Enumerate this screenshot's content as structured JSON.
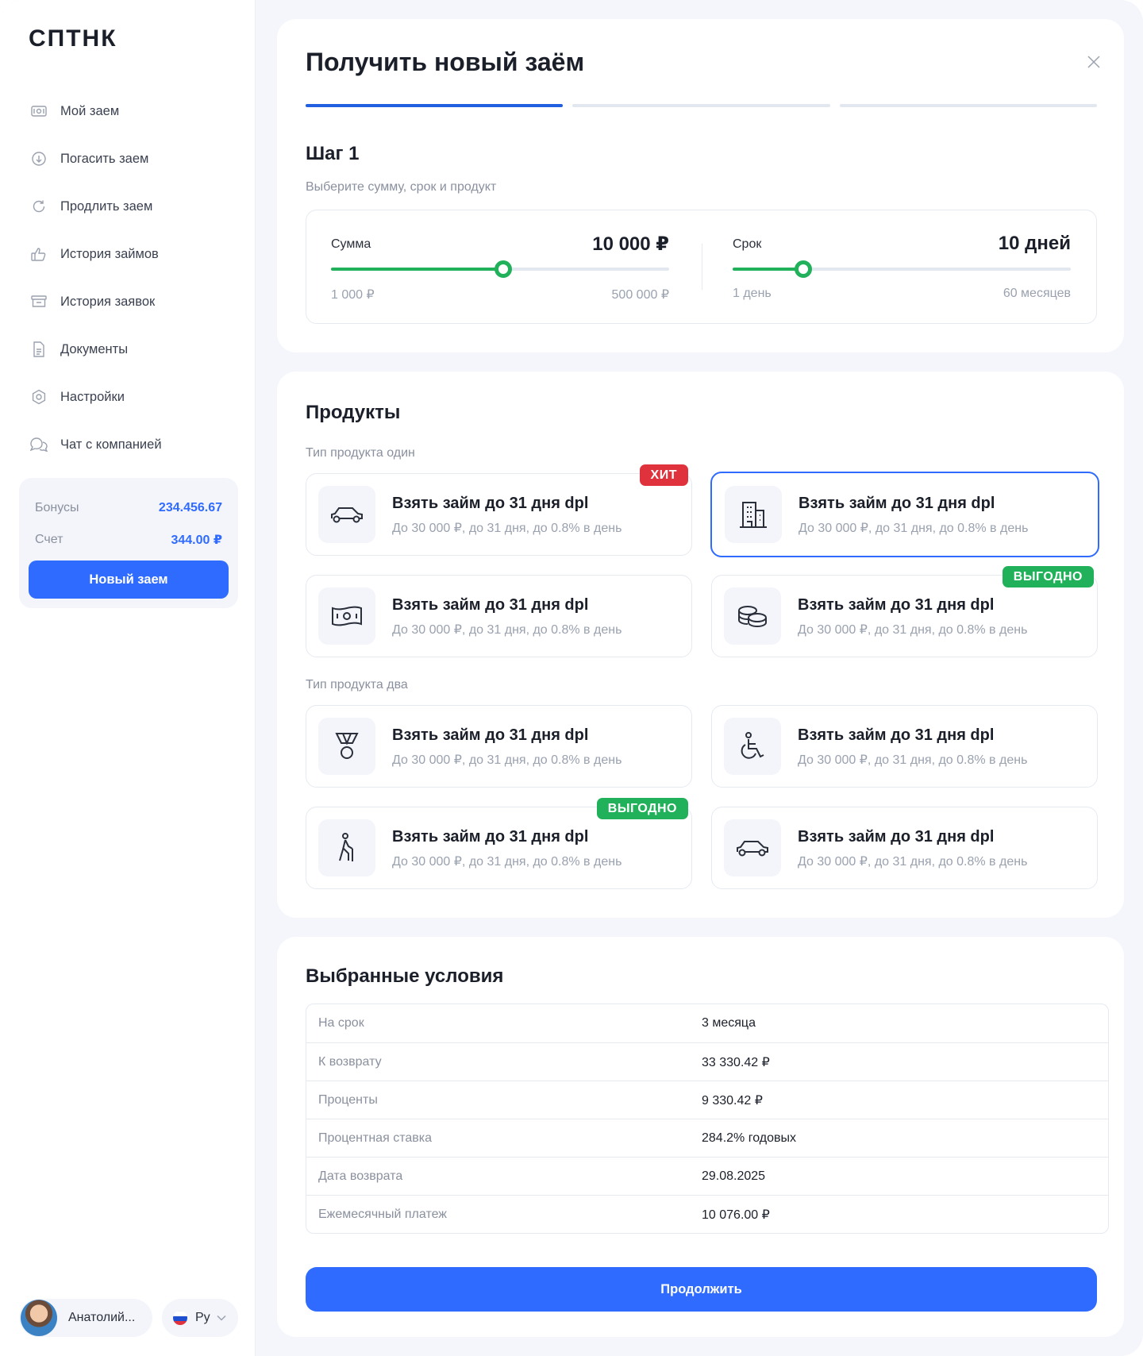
{
  "sidebar": {
    "logo": "СПТНК",
    "items": [
      {
        "label": "Мой заем",
        "icon": "money-icon"
      },
      {
        "label": "Погасить заем",
        "icon": "arrow-down-circle-icon"
      },
      {
        "label": "Продлить заем",
        "icon": "refresh-icon"
      },
      {
        "label": "История займов",
        "icon": "thumb-up-icon"
      },
      {
        "label": "История заявок",
        "icon": "archive-icon"
      },
      {
        "label": "Документы",
        "icon": "document-icon"
      },
      {
        "label": "Настройки",
        "icon": "gear-icon"
      },
      {
        "label": "Чат с компанией",
        "icon": "chat-icon"
      }
    ],
    "wallet": {
      "bonus_label": "Бонусы",
      "bonus_value": "234.456.67",
      "account_label": "Счет",
      "account_value": "344.00 ₽",
      "new_loan": "Новый заем"
    },
    "user": {
      "name": "Анатолий..."
    },
    "lang": {
      "code": "Ру"
    }
  },
  "step": {
    "title": "Получить новый заём",
    "progress": {
      "current": 1,
      "total": 3
    },
    "heading": "Шаг 1",
    "subtitle": "Выберите сумму, срок и продукт",
    "amount": {
      "label": "Сумма",
      "value": "10 000 ₽",
      "min": "1 000 ₽",
      "max": "500 000 ₽",
      "fraction": 0.51
    },
    "term": {
      "label": "Срок",
      "value": "10 дней",
      "min": "1 день",
      "max": "60 месяцев",
      "fraction": 0.21
    }
  },
  "products": {
    "heading": "Продукты",
    "group1": "Тип продукта один",
    "group2": "Тип продукта два",
    "items": [
      {
        "title": "Взять займ до 31 дня dpl",
        "desc": "До 30 000 ₽, до 31 дня, до 0.8% в день",
        "icon": "car-icon",
        "badge": "ХИТ"
      },
      {
        "title": "Взять займ до 31 дня dpl",
        "desc": "До 30 000 ₽, до 31 дня, до 0.8% в день",
        "icon": "building-icon",
        "badge": ""
      },
      {
        "title": "Взять займ до 31 дня dpl",
        "desc": "До 30 000 ₽, до 31 дня, до 0.8% в день",
        "icon": "banknote-icon",
        "badge": ""
      },
      {
        "title": "Взять займ до 31 дня dpl",
        "desc": "До 30 000 ₽, до 31 дня, до 0.8% в день",
        "icon": "coins-icon",
        "badge": "ВЫГОДНО"
      },
      {
        "title": "Взять займ до 31 дня dpl",
        "desc": "До 30 000 ₽, до 31 дня, до 0.8% в день",
        "icon": "medal-icon",
        "badge": ""
      },
      {
        "title": "Взять займ до 31 дня dpl",
        "desc": "До 30 000 ₽, до 31 дня, до 0.8% в день",
        "icon": "wheelchair-icon",
        "badge": ""
      },
      {
        "title": "Взять займ до 31 дня dpl",
        "desc": "До 30 000 ₽, до 31 дня, до 0.8% в день",
        "icon": "elderly-icon",
        "badge": "ВЫГОДНО"
      },
      {
        "title": "Взять займ до 31 дня dpl",
        "desc": "До 30 000 ₽, до 31 дня, до 0.8% в день",
        "icon": "car-icon",
        "badge": ""
      }
    ]
  },
  "conditions": {
    "heading": "Выбранные условия",
    "rows": [
      {
        "k": "На срок",
        "v": "3 месяца"
      },
      {
        "k": "К возврату",
        "v": "33 330.42 ₽"
      },
      {
        "k": "Проценты",
        "v": "9 330.42 ₽"
      },
      {
        "k": "Процентная ставка",
        "v": "284.2% годовых"
      },
      {
        "k": "Дата возврата",
        "v": "29.08.2025"
      },
      {
        "k": "Ежемесячный платеж",
        "v": "10 076.00 ₽"
      }
    ],
    "continue": "Продолжить"
  },
  "colors": {
    "accent": "#2f6bff",
    "success": "#22b15b",
    "danger": "#e0323c"
  }
}
